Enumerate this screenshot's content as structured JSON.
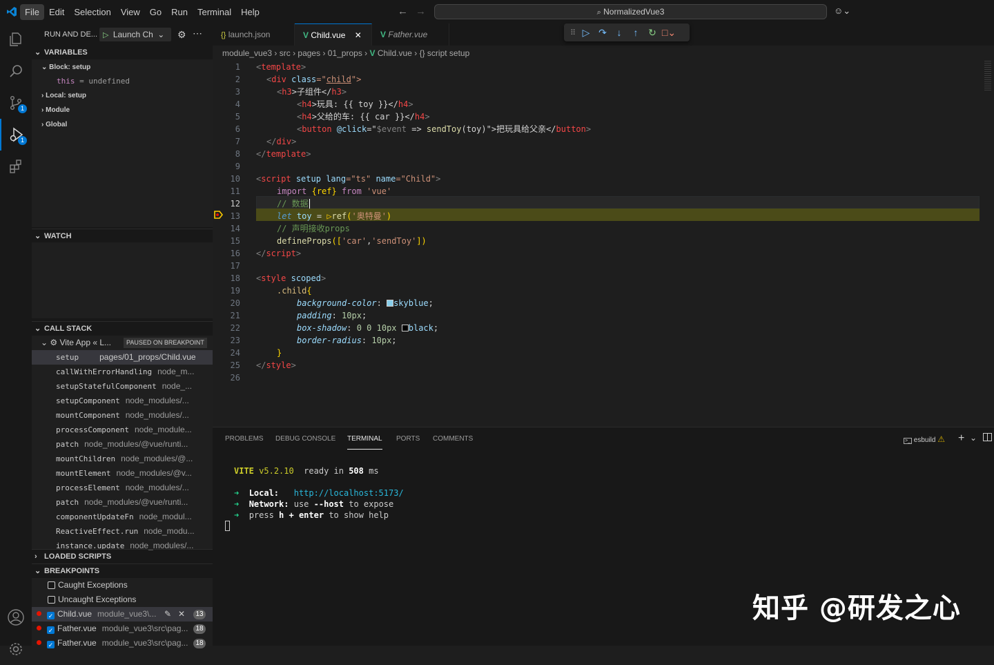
{
  "menu": [
    "File",
    "Edit",
    "Selection",
    "View",
    "Go",
    "Run",
    "Terminal",
    "Help"
  ],
  "command_center": "NormalizedVue3",
  "sidebar": {
    "run_label": "RUN AND DE...",
    "launch_config": "Launch Ch",
    "variables_header": "VARIABLES",
    "block_setup": "Block: setup",
    "this_var": "this",
    "this_eq": "=",
    "this_val": "undefined",
    "local_setup": "Local: setup",
    "module": "Module",
    "global": "Global",
    "watch_header": "WATCH",
    "callstack_header": "CALL STACK",
    "callstack_thread": "Vite App « L...",
    "paused_badge": "PAUSED ON BREAKPOINT",
    "frames": [
      {
        "name": "setup",
        "path": "pages/01_props/Child.vue"
      },
      {
        "name": "callWithErrorHandling",
        "path": "node_m..."
      },
      {
        "name": "setupStatefulComponent",
        "path": "node_..."
      },
      {
        "name": "setupComponent",
        "path": "node_modules/..."
      },
      {
        "name": "mountComponent",
        "path": "node_modules/..."
      },
      {
        "name": "processComponent",
        "path": "node_module..."
      },
      {
        "name": "patch",
        "path": "node_modules/@vue/runti..."
      },
      {
        "name": "mountChildren",
        "path": "node_modules/@..."
      },
      {
        "name": "mountElement",
        "path": "node_modules/@v..."
      },
      {
        "name": "processElement",
        "path": "node_modules/..."
      },
      {
        "name": "patch",
        "path": "node_modules/@vue/runti..."
      },
      {
        "name": "componentUpdateFn",
        "path": "node_modul..."
      },
      {
        "name": "ReactiveEffect.run",
        "path": "node_modu..."
      },
      {
        "name": "instance.update",
        "path": "node_modules/..."
      }
    ],
    "loaded_scripts_header": "LOADED SCRIPTS",
    "breakpoints_header": "BREAKPOINTS",
    "caught_exceptions": "Caught Exceptions",
    "uncaught_exceptions": "Uncaught Exceptions",
    "breakpoints": [
      {
        "file": "Child.vue",
        "path": "module_vue3\\...",
        "line": "13"
      },
      {
        "file": "Father.vue",
        "path": "module_vue3\\src\\pag...",
        "line": "18"
      },
      {
        "file": "Father.vue",
        "path": "module_vue3\\src\\pag...",
        "line": "18"
      }
    ]
  },
  "tabs": [
    {
      "icon": "{}",
      "label": "launch.json"
    },
    {
      "icon": "V",
      "label": "Child.vue"
    },
    {
      "icon": "V",
      "label": "Father.vue"
    }
  ],
  "breadcrumb": [
    "module_vue3",
    "src",
    "pages",
    "01_props",
    "Child.vue",
    "{} script setup"
  ],
  "line_numbers": [
    "1",
    "2",
    "3",
    "4",
    "5",
    "6",
    "7",
    "8",
    "9",
    "10",
    "11",
    "12",
    "13",
    "14",
    "15",
    "16",
    "17",
    "18",
    "19",
    "20",
    "21",
    "22",
    "23",
    "24",
    "25",
    "26"
  ],
  "code": {
    "l1_a": "<",
    "l1_b": "template",
    "l1_c": ">",
    "l2_a": "<",
    "l2_b": "div",
    "l2_c": "class",
    "l2_d": "=\"",
    "l2_e": "child",
    "l2_f": "\">",
    "l3_a": "<",
    "l3_b": "h3",
    "l3_c": ">子组件</",
    "l3_d": "h3",
    "l3_e": ">",
    "l4_a": "<",
    "l4_b": "h4",
    "l4_c": ">玩具: {{ ",
    "l4_d": "toy",
    "l4_e": " }}</",
    "l4_f": "h4",
    "l4_g": ">",
    "l5_a": "<",
    "l5_b": "h4",
    "l5_c": ">父给的车: {{ ",
    "l5_d": "car",
    "l5_e": " }}</",
    "l5_f": "h4",
    "l5_g": ">",
    "l6_a": "<",
    "l6_b": "button",
    "l6_c": "@click",
    "l6_d": "=\"",
    "l6_e": "$event",
    "l6_f": " => ",
    "l6_g": "sendToy",
    "l6_h": "(toy)\"",
    "l6_i": ">把玩具给父亲</",
    "l6_j": "button",
    "l6_k": ">",
    "l7_a": "</",
    "l7_b": "div",
    "l7_c": ">",
    "l8_a": "</",
    "l8_b": "template",
    "l8_c": ">",
    "l10_a": "<",
    "l10_b": "script",
    "l10_c": "setup",
    "l10_d": "lang",
    "l10_e": "=\"ts\"",
    "l10_f": "name",
    "l10_g": "=\"Child\"",
    "l10_h": ">",
    "l11_a": "import",
    "l11_b": "{ref}",
    "l11_c": "from",
    "l11_d": "'vue'",
    "l12_a": "// 数据",
    "l13_a": "let",
    "l13_b": "toy",
    "l13_c": "=",
    "l13_d": "ref",
    "l13_e": "(",
    "l13_f": "'奥特曼'",
    "l13_g": ")",
    "l14_a": "// 声明接收props",
    "l15_a": "defineProps",
    "l15_b": "([",
    "l15_c": "'car'",
    "l15_d": ",",
    "l15_e": "'sendToy'",
    "l15_f": "])",
    "l16_a": "</",
    "l16_b": "script",
    "l16_c": ">",
    "l18_a": "<",
    "l18_b": "style",
    "l18_c": "scoped",
    "l18_d": ">",
    "l19_a": ".child",
    "l19_b": "{",
    "l20_a": "background-color",
    "l20_b": ":",
    "l20_c": "skyblue",
    "l20_d": ";",
    "l21_a": "padding",
    "l21_b": ":",
    "l21_c": "10px",
    "l21_d": ";",
    "l22_a": "box-shadow",
    "l22_b": ":",
    "l22_c": "0 0 10px",
    "l22_d": "black",
    "l22_e": ";",
    "l23_a": "border-radius",
    "l23_b": ":",
    "l23_c": "10px",
    "l23_d": ";",
    "l24_a": "}",
    "l25_a": "</",
    "l25_b": "style",
    "l25_c": ">"
  },
  "panel": {
    "tabs": [
      "PROBLEMS",
      "DEBUG CONSOLE",
      "TERMINAL",
      "PORTS",
      "COMMENTS"
    ],
    "terminal_name": "esbuild"
  },
  "terminal": {
    "vite": "VITE",
    "version": "v5.2.10",
    "ready": "ready in",
    "ms_num": "508",
    "ms": "ms",
    "arrow": "➜",
    "local_label": "Local:",
    "local_url": "http://localhost:5173/",
    "network_label": "Network:",
    "network_text1": "use",
    "network_flag": "--host",
    "network_text2": "to expose",
    "help_text1": "press",
    "help_key": "h + enter",
    "help_text2": "to show help"
  },
  "watermark": "知乎 @研发之心",
  "colors": {
    "accent": "#0078d4",
    "breakpoint": "#e51400",
    "vue_green": "#41b883",
    "skyblue": "#87ceeb"
  }
}
